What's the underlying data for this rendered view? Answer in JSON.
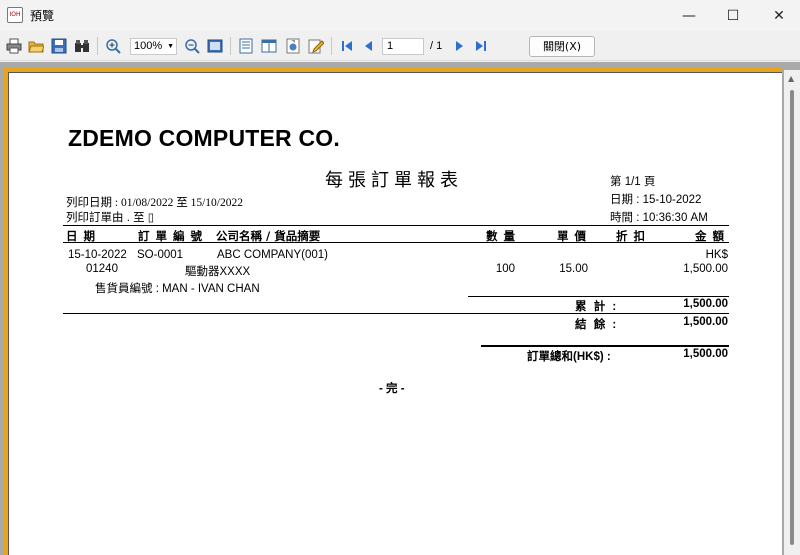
{
  "window": {
    "title": "預覽",
    "app_icon_text": "IOH",
    "minimize_glyph": "—",
    "maximize_glyph": "☐",
    "close_glyph": "✕"
  },
  "toolbar": {
    "zoom": "100%",
    "page_current": "1",
    "page_total": "/ 1",
    "close_label": "關閉(X)",
    "icons": [
      "print-icon",
      "open-folder-icon",
      "save-icon",
      "find-icon",
      "zoom-in-icon",
      "zoom-out-icon",
      "fit-page-icon",
      "single-page-icon",
      "two-page-icon",
      "export-icon",
      "edit-icon",
      "first-page-icon",
      "prev-page-icon",
      "next-page-icon",
      "last-page-icon"
    ]
  },
  "report": {
    "company": "ZDEMO COMPUTER CO.",
    "title": "每張訂單報表",
    "page_label": "第 1/1 頁",
    "date_label": "日期 : 15-10-2022",
    "time_label": "時間 : 10:36:30 AM",
    "print_date": "列印日期 : 01/08/2022 至 15/10/2022",
    "print_order": "列印訂單由 . 至 ▯",
    "headers": {
      "date": "日 期",
      "order_no": "訂 單 編 號",
      "company_desc": "公司名稱 / 貨品摘要",
      "qty": "數 量",
      "price": "單 價",
      "discount": "折 扣",
      "amount": "金 額"
    },
    "order": {
      "date": "15-10-2022",
      "order_no": "SO-0001",
      "company": "ABC COMPANY(001)",
      "currency": "HK$",
      "item_code": "01240",
      "item_desc": "驅動器XXXX",
      "qty": "100",
      "price": "15.00",
      "amount": "1,500.00",
      "salesman": "售貨員編號 : MAN - IVAN CHAN"
    },
    "totals": {
      "cumulative_label": "累 計 :",
      "cumulative_value": "1,500.00",
      "balance_label": "結 餘 :",
      "balance_value": "1,500.00",
      "grand_label": "訂單總和(HK$) :",
      "grand_value": "1,500.00"
    },
    "end_text": "- 完 -"
  }
}
